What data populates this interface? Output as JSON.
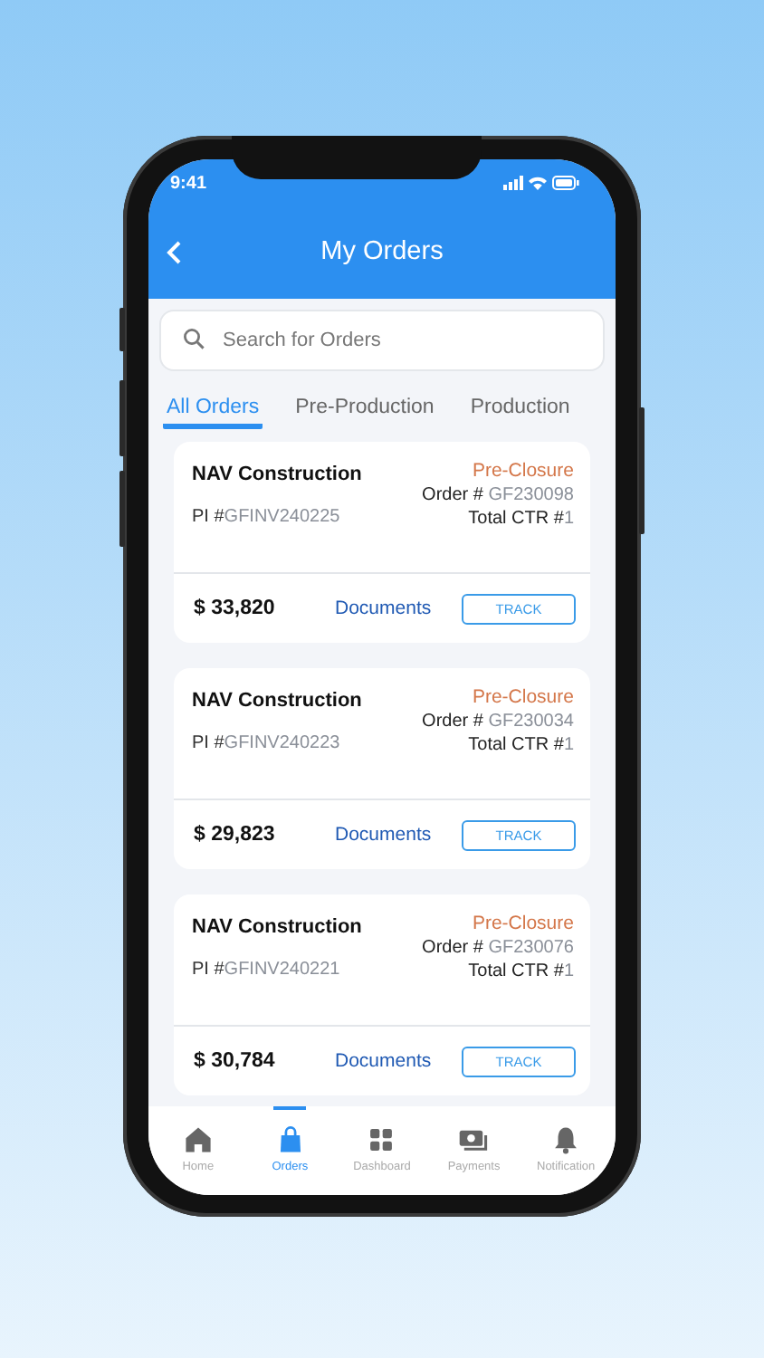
{
  "status_bar": {
    "time": "9:41"
  },
  "header": {
    "title": "My Orders"
  },
  "search": {
    "placeholder": "Search for Orders"
  },
  "tabs": [
    {
      "label": "All Orders",
      "selected": true
    },
    {
      "label": "Pre-Production",
      "selected": false
    },
    {
      "label": "Production",
      "selected": false
    }
  ],
  "orders": [
    {
      "customer": "NAV Construction",
      "status": "Pre-Closure",
      "pi_label": "PI #",
      "pi_number": "GFINV240225",
      "order_label": "Order #",
      "order_number": "GF230098",
      "ctr_label": "Total CTR #",
      "ctr_count": "1",
      "amount": "$ 33,820",
      "documents": "Documents",
      "action": "TRACK"
    },
    {
      "customer": "NAV Construction",
      "status": "Pre-Closure",
      "pi_label": "PI #",
      "pi_number": "GFINV240223",
      "order_label": "Order #",
      "order_number": "GF230034",
      "ctr_label": "Total CTR #",
      "ctr_count": "1",
      "amount": "$ 29,823",
      "documents": "Documents",
      "action": "TRACK"
    },
    {
      "customer": "NAV Construction",
      "status": "Pre-Closure",
      "pi_label": "PI #",
      "pi_number": "GFINV240221",
      "order_label": "Order #",
      "order_number": "GF230076",
      "ctr_label": "Total CTR #",
      "ctr_count": "1",
      "amount": "$ 30,784",
      "documents": "Documents",
      "action": "TRACK"
    }
  ],
  "bottom_nav": [
    {
      "label": "Home",
      "kind": "home",
      "selected": false
    },
    {
      "label": "Orders",
      "kind": "bag",
      "selected": true
    },
    {
      "label": "Dashboard",
      "kind": "grid",
      "selected": false
    },
    {
      "label": "Payments",
      "kind": "cash",
      "selected": false
    },
    {
      "label": "Notification",
      "kind": "bell",
      "selected": false
    }
  ]
}
